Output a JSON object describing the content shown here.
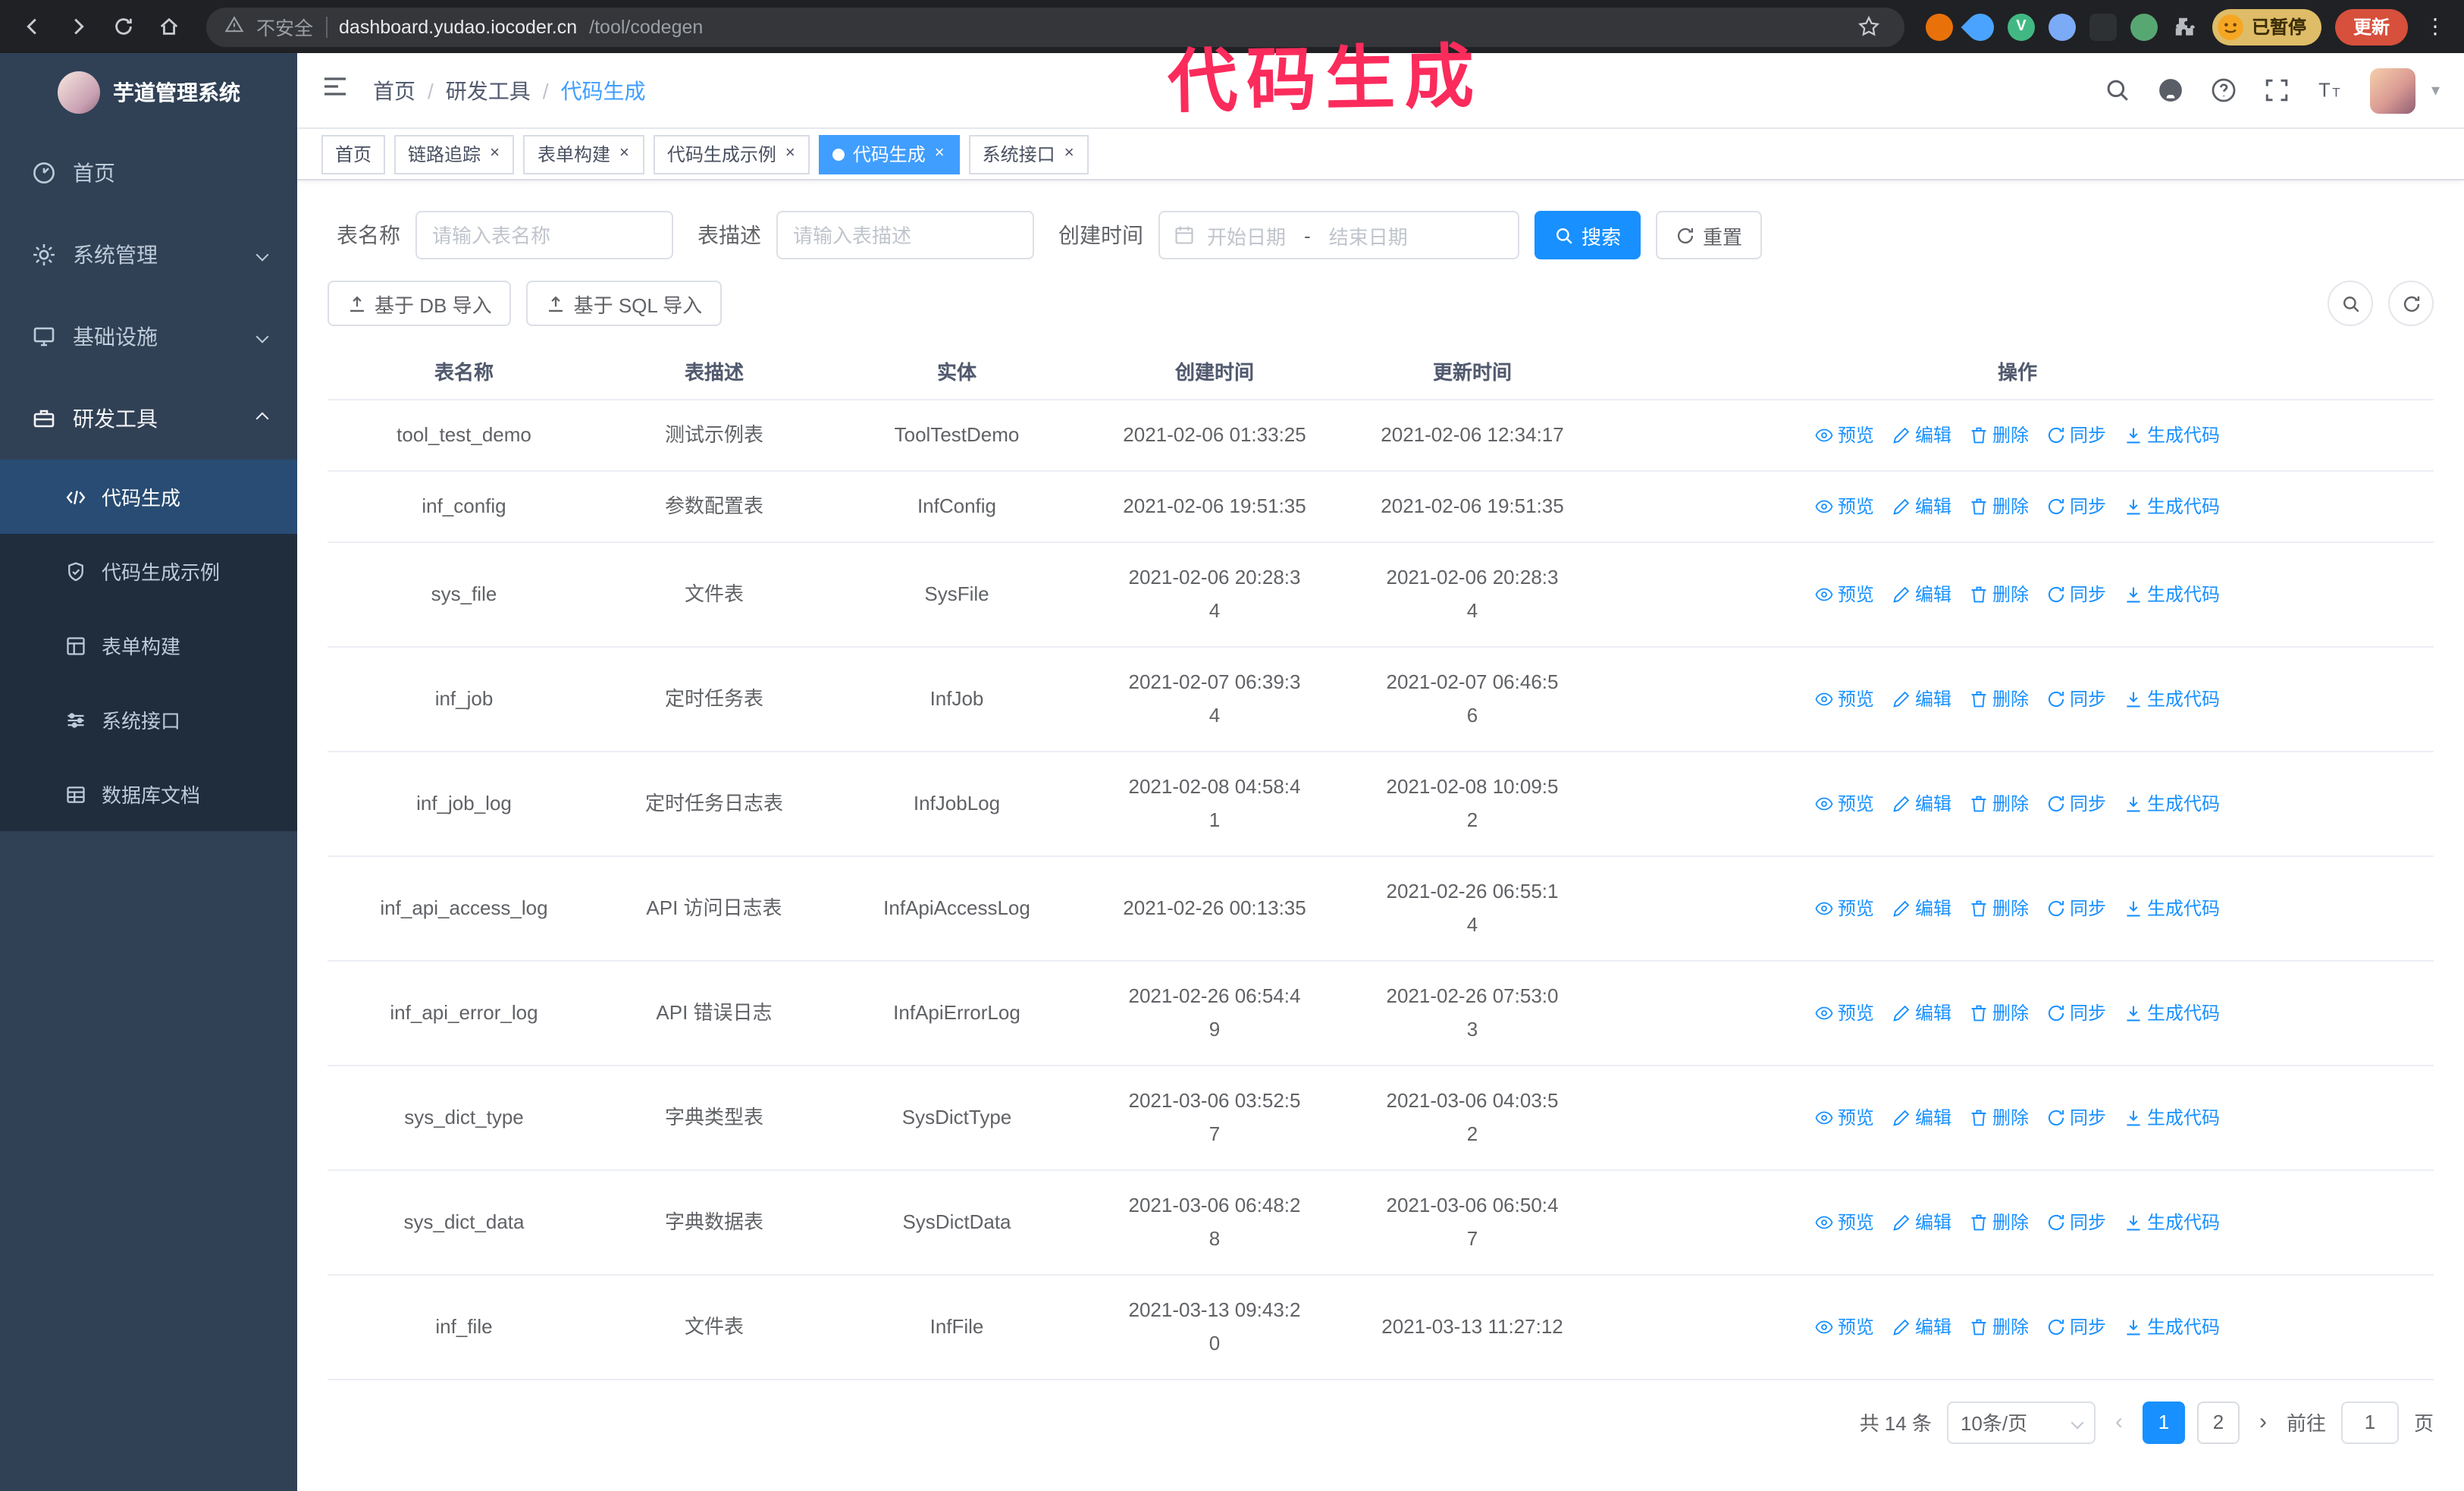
{
  "browser": {
    "security_label": "不安全",
    "url_domain": "dashboard.yudao.iocoder.cn",
    "url_path": "/tool/codegen",
    "paused_badge": "已暂停",
    "update_button": "更新",
    "extensions": [
      {
        "id": "fox-extension-icon",
        "shape": "circle",
        "color": "#e8710a",
        "glyph": ""
      },
      {
        "id": "water-drop-extension-icon",
        "shape": "drop",
        "color": "#4aa3ff",
        "glyph": ""
      },
      {
        "id": "vue-devtools-extension-icon",
        "shape": "circle",
        "color": "#41b883",
        "glyph": "V"
      },
      {
        "id": "accounts-extension-icon",
        "shape": "circle",
        "color": "#7baaf7",
        "glyph": ""
      },
      {
        "id": "screenshot-extension-icon",
        "shape": "square",
        "color": "#2d3134",
        "glyph": ""
      },
      {
        "id": "leaf-extension-icon",
        "shape": "circle",
        "color": "#57a773",
        "glyph": ""
      },
      {
        "id": "puzzle-extensions-icon",
        "shape": "puzzle",
        "color": "",
        "glyph": ""
      }
    ]
  },
  "annotation": {
    "text": "代码生成",
    "color": "#fb2b5c"
  },
  "sidebar": {
    "logo_title": "芋道管理系统",
    "items": [
      {
        "id": "home",
        "label": "首页",
        "icon": "dashboard-icon",
        "chevron": ""
      },
      {
        "id": "system",
        "label": "系统管理",
        "icon": "gear-icon",
        "chevron": "down"
      },
      {
        "id": "infra",
        "label": "基础设施",
        "icon": "infra-icon",
        "chevron": "down"
      },
      {
        "id": "devtools",
        "label": "研发工具",
        "icon": "toolbox-icon",
        "chevron": "up",
        "expanded": true
      }
    ],
    "subitems": [
      {
        "id": "codegen",
        "label": "代码生成",
        "icon": "code-icon",
        "active": true
      },
      {
        "id": "codegen-example",
        "label": "代码生成示例",
        "icon": "shield-icon",
        "active": false
      },
      {
        "id": "form-builder",
        "label": "表单构建",
        "icon": "form-icon",
        "active": false
      },
      {
        "id": "system-api",
        "label": "系统接口",
        "icon": "sliders-icon",
        "active": false
      },
      {
        "id": "db-doc",
        "label": "数据库文档",
        "icon": "db-doc-icon",
        "active": false
      }
    ]
  },
  "topbar": {
    "breadcrumb": [
      "首页",
      "研发工具",
      "代码生成"
    ]
  },
  "tabs": [
    {
      "id": "home",
      "label": "首页",
      "closable": false,
      "active": false
    },
    {
      "id": "tracing",
      "label": "链路追踪",
      "closable": true,
      "active": false
    },
    {
      "id": "form-builder",
      "label": "表单构建",
      "closable": true,
      "active": false
    },
    {
      "id": "codegen-example",
      "label": "代码生成示例",
      "closable": true,
      "active": false
    },
    {
      "id": "codegen",
      "label": "代码生成",
      "closable": true,
      "active": true
    },
    {
      "id": "system-api",
      "label": "系统接口",
      "closable": true,
      "active": false
    }
  ],
  "search_form": {
    "table_name_label": "表名称",
    "table_name_placeholder": "请输入表名称",
    "table_desc_label": "表描述",
    "table_desc_placeholder": "请输入表描述",
    "create_time_label": "创建时间",
    "date_start_placeholder": "开始日期",
    "date_separator": "-",
    "date_end_placeholder": "结束日期",
    "search_button": "搜索",
    "reset_button": "重置"
  },
  "toolbar": {
    "import_db_button": "基于 DB 导入",
    "import_sql_button": "基于 SQL 导入"
  },
  "table": {
    "columns": [
      "表名称",
      "表描述",
      "实体",
      "创建时间",
      "更新时间",
      "操作"
    ],
    "actions": [
      {
        "label": "预览",
        "icon": "eye-icon"
      },
      {
        "label": "编辑",
        "icon": "edit-icon"
      },
      {
        "label": "删除",
        "icon": "delete-icon"
      },
      {
        "label": "同步",
        "icon": "sync-icon"
      },
      {
        "label": "生成代码",
        "icon": "generate-code-icon"
      }
    ],
    "rows": [
      {
        "name": "tool_test_demo",
        "desc": "测试示例表",
        "entity": "ToolTestDemo",
        "created": "2021-02-06 01:33:25",
        "updated": "2021-02-06 12:34:17"
      },
      {
        "name": "inf_config",
        "desc": "参数配置表",
        "entity": "InfConfig",
        "created": "2021-02-06 19:51:35",
        "updated": "2021-02-06 19:51:35"
      },
      {
        "name": "sys_file",
        "desc": "文件表",
        "entity": "SysFile",
        "created": "2021-02-06 20:28:3\n4",
        "updated": "2021-02-06 20:28:3\n4"
      },
      {
        "name": "inf_job",
        "desc": "定时任务表",
        "entity": "InfJob",
        "created": "2021-02-07 06:39:3\n4",
        "updated": "2021-02-07 06:46:5\n6"
      },
      {
        "name": "inf_job_log",
        "desc": "定时任务日志表",
        "entity": "InfJobLog",
        "created": "2021-02-08 04:58:4\n1",
        "updated": "2021-02-08 10:09:5\n2"
      },
      {
        "name": "inf_api_access_log",
        "desc": "API 访问日志表",
        "entity": "InfApiAccessLog",
        "created": "2021-02-26 00:13:35",
        "updated": "2021-02-26 06:55:1\n4"
      },
      {
        "name": "inf_api_error_log",
        "desc": "API 错误日志",
        "entity": "InfApiErrorLog",
        "created": "2021-02-26 06:54:4\n9",
        "updated": "2021-02-26 07:53:0\n3"
      },
      {
        "name": "sys_dict_type",
        "desc": "字典类型表",
        "entity": "SysDictType",
        "created": "2021-03-06 03:52:5\n7",
        "updated": "2021-03-06 04:03:5\n2"
      },
      {
        "name": "sys_dict_data",
        "desc": "字典数据表",
        "entity": "SysDictData",
        "created": "2021-03-06 06:48:2\n8",
        "updated": "2021-03-06 06:50:4\n7"
      },
      {
        "name": "inf_file",
        "desc": "文件表",
        "entity": "InfFile",
        "created": "2021-03-13 09:43:2\n0",
        "updated": "2021-03-13 11:27:12"
      }
    ]
  },
  "pagination": {
    "total_text": "共 14 条",
    "page_size": "10条/页",
    "pages": [
      {
        "label": "1",
        "active": true
      },
      {
        "label": "2",
        "active": false
      }
    ],
    "goto_label": "前往",
    "goto_value": "1",
    "goto_suffix": "页"
  },
  "colors": {
    "primary": "#1890ff",
    "sidebar_bg": "#304156",
    "submenu_bg": "#1f2d3d",
    "annotation": "#fb2b5c"
  }
}
